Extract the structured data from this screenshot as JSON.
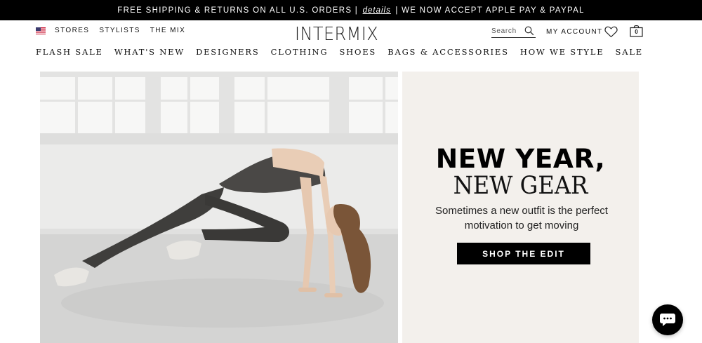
{
  "promo": {
    "text_before": "FREE SHIPPING & RETURNS ON ALL U.S. ORDERS |",
    "link": "details",
    "text_after": "| WE NOW ACCEPT APPLE PAY & PAYPAL"
  },
  "utility_nav": {
    "flag_icon": "us-flag-icon",
    "stores": "STORES",
    "stylists": "STYLISTS",
    "the_mix": "THE MIX"
  },
  "logo": "INTERMIX",
  "search": {
    "placeholder": "Search",
    "icon": "search-icon"
  },
  "account": {
    "label": "MY ACCOUNT"
  },
  "wishlist": {
    "icon": "heart-icon"
  },
  "bag": {
    "icon": "bag-icon",
    "count": "0"
  },
  "main_nav": [
    "FLASH SALE",
    "WHAT'S NEW",
    "DESIGNERS",
    "CLOTHING",
    "SHOES",
    "BAGS & ACCESSORIES",
    "HOW WE STYLE",
    "SALE"
  ],
  "hero": {
    "headline": "NEW YEAR,",
    "subheadline": "NEW GEAR",
    "tagline": "Sometimes a new outfit is the perfect motivation to get moving",
    "cta": "SHOP THE EDIT",
    "photo": "woman-doing-workout-stretch-photo"
  },
  "chat": {
    "icon": "chat-bubble-icon"
  },
  "colors": {
    "promo_bg": "#000000",
    "panel_bg": "#f3f0ec",
    "cta_bg": "#000000"
  }
}
